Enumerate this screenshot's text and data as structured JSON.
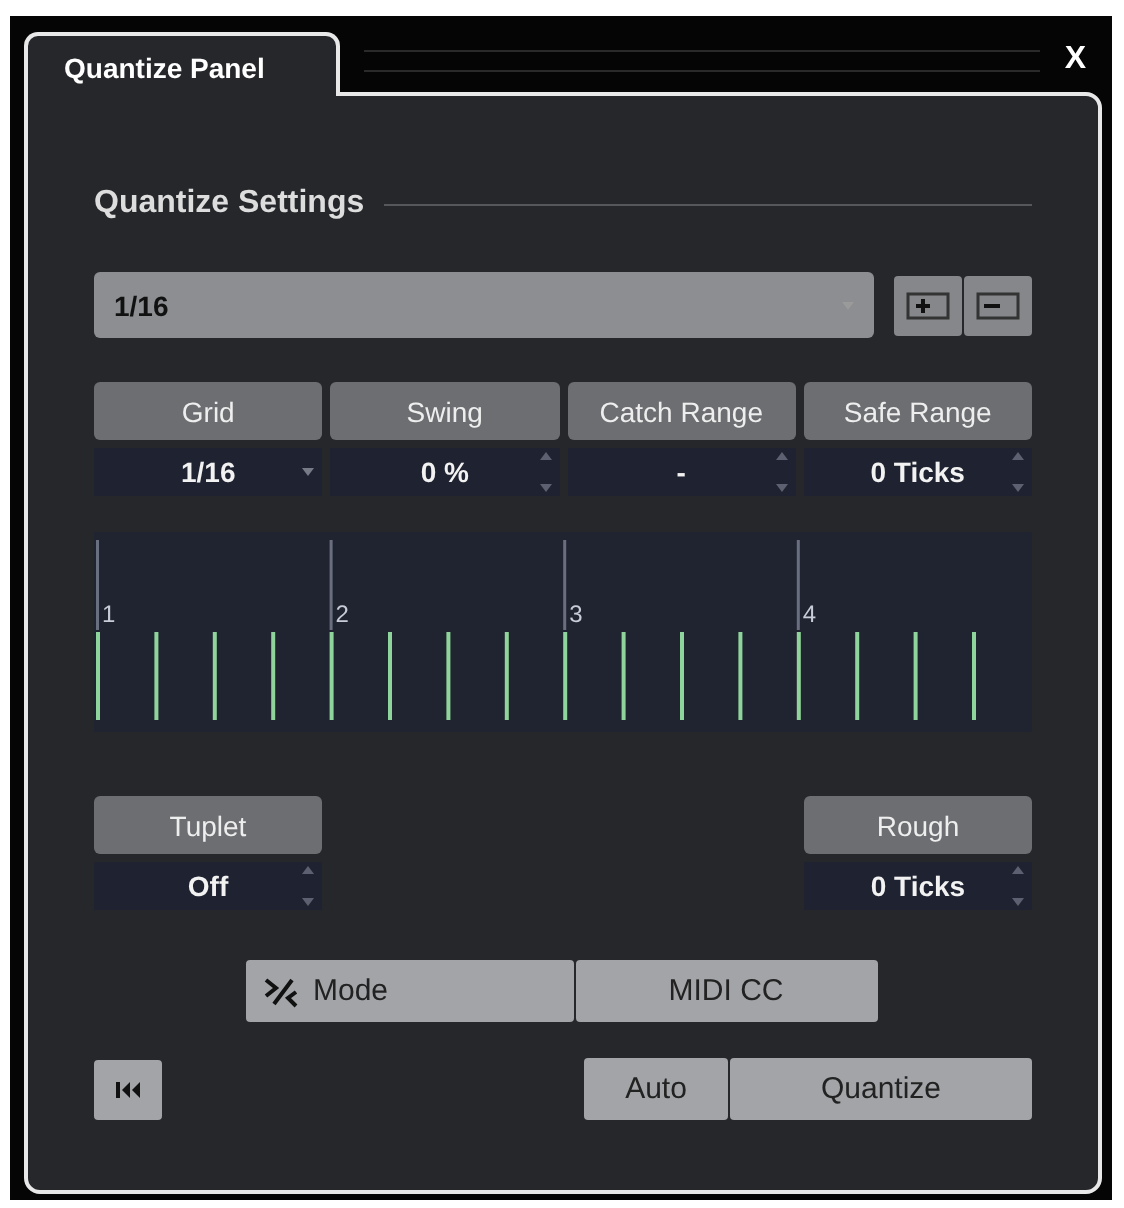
{
  "window": {
    "tabs": [
      {
        "label": "Quantize Panel",
        "selected": true
      }
    ],
    "close": "X"
  },
  "section_title": "Quantize Settings",
  "preset": {
    "value": "1/16"
  },
  "parameters": [
    {
      "label": "Grid",
      "value": "1/16",
      "kind": "dropdown"
    },
    {
      "label": "Swing",
      "value": "0 %",
      "kind": "spinner"
    },
    {
      "label": "Catch Range",
      "value": "-",
      "kind": "spinner"
    },
    {
      "label": "Safe Range",
      "value": "0 Ticks",
      "kind": "spinner"
    }
  ],
  "grid_display": {
    "beats": [
      "1",
      "2",
      "3",
      "4"
    ]
  },
  "tuplet": {
    "label": "Tuplet",
    "value": "Off",
    "kind": "spinner"
  },
  "rough": {
    "label": "Rough",
    "value": "0 Ticks",
    "kind": "spinner"
  },
  "mode_buttons": [
    {
      "label": "Mode",
      "kind": "icon"
    },
    {
      "label": "MIDI CC",
      "kind": "plain"
    }
  ],
  "action_buttons": [
    {
      "label": "Auto"
    },
    {
      "label": "Quantize"
    }
  ]
}
